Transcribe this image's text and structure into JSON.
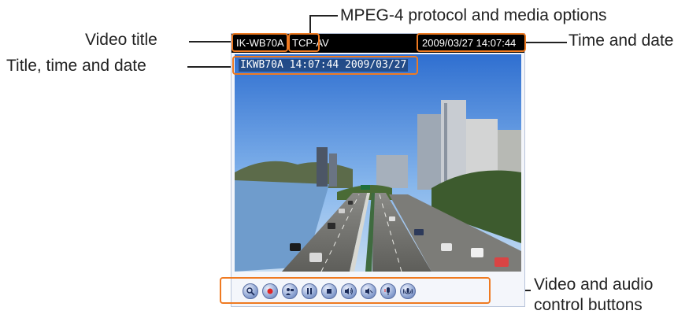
{
  "callouts": {
    "video_title": "Video title",
    "mpeg4": "MPEG-4 protocol and media options",
    "title_time_date": "Title, time and date",
    "time_date": "Time and date",
    "controls_line1": "Video and audio",
    "controls_line2": "control buttons"
  },
  "viewer": {
    "title": "IK-WB70A",
    "protocol": "TCP-AV",
    "datetime": "2009/03/27 14:07:44",
    "overlay": "IKWB70A 14:07:44 2009/03/27"
  },
  "controls": [
    {
      "icon": "magnifier-icon"
    },
    {
      "icon": "record-icon"
    },
    {
      "icon": "snapshot-icon"
    },
    {
      "icon": "pause-icon"
    },
    {
      "icon": "stop-icon"
    },
    {
      "icon": "volume-icon"
    },
    {
      "icon": "mute-icon"
    },
    {
      "icon": "talk-icon"
    },
    {
      "icon": "mic-icon"
    }
  ],
  "colors": {
    "highlight": "#ef7a21",
    "bar": "#000000",
    "button": "#8fa5d3"
  }
}
